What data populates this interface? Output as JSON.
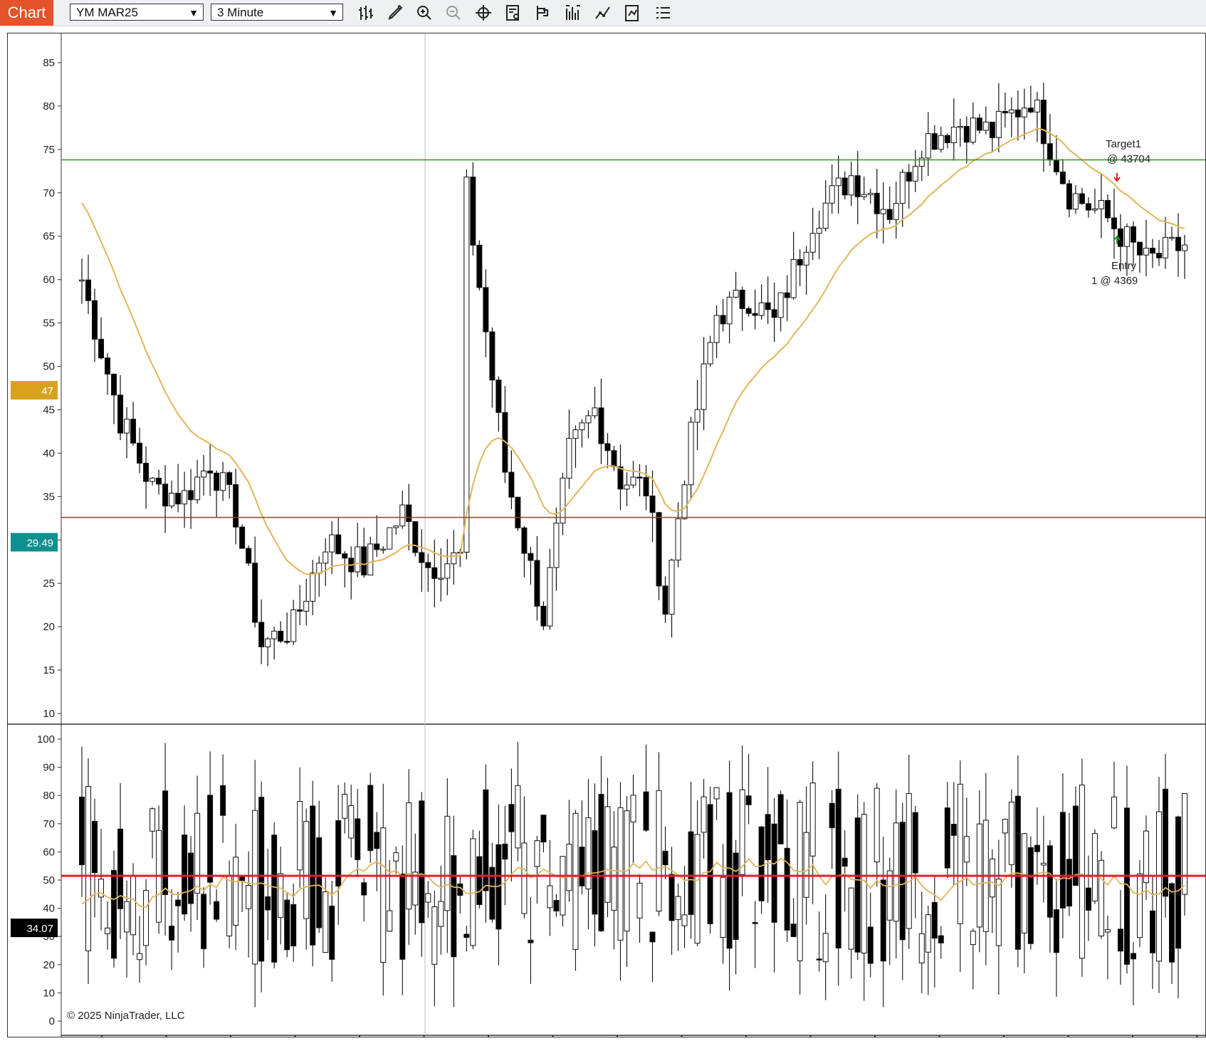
{
  "toolbar": {
    "tab_label": "Chart",
    "instrument": "YM MAR25",
    "interval": "3 Minute",
    "icons": [
      "bar-type-icon",
      "pencil-icon",
      "zoom-in-icon",
      "zoom-out-icon",
      "crosshair-icon",
      "data-box-icon",
      "strategy-icon",
      "indicators-icon",
      "chart-style-icon",
      "properties-icon",
      "object-list-icon"
    ]
  },
  "colors": {
    "accent_tab": "#e4532a",
    "ma_line": "#e3b55a",
    "target_line": "#1f9b1f",
    "level_line": "#e8192c",
    "label_gold": "#d9a21e",
    "label_teal": "#0f8f8f",
    "label_black": "#000000"
  },
  "annotations": {
    "target_label": "Target1",
    "target_price": "@ 43704",
    "entry_label": "Entry",
    "entry_price": "1 @ 4369",
    "copyright": "© 2025 NinjaTrader, LLC"
  },
  "chart_data": [
    {
      "type": "candlestick",
      "panel": "price",
      "y_ticks": [
        "85",
        "80",
        "75",
        "70",
        "65",
        "60",
        "55",
        "50",
        "45",
        "40",
        "35",
        "30",
        "25",
        "20",
        "15",
        "10"
      ],
      "ylim": [
        10,
        87
      ],
      "markers": {
        "gold_value": "47",
        "teal_value": "29.49"
      },
      "horizontal_lines": [
        {
          "name": "target",
          "value": 73.8
        },
        {
          "name": "level",
          "value": 32.6
        }
      ],
      "series_shape": [
        {
          "i": 0,
          "v": 60
        },
        {
          "i": 6,
          "v": 44
        },
        {
          "i": 11,
          "v": 36
        },
        {
          "i": 16,
          "v": 35
        },
        {
          "i": 20,
          "v": 39
        },
        {
          "i": 24,
          "v": 33
        },
        {
          "i": 28,
          "v": 18
        },
        {
          "i": 33,
          "v": 20
        },
        {
          "i": 38,
          "v": 30
        },
        {
          "i": 44,
          "v": 27
        },
        {
          "i": 50,
          "v": 33
        },
        {
          "i": 54,
          "v": 27
        },
        {
          "i": 59,
          "v": 28
        },
        {
          "i": 60,
          "v": 70
        },
        {
          "i": 66,
          "v": 38
        },
        {
          "i": 72,
          "v": 21
        },
        {
          "i": 76,
          "v": 40
        },
        {
          "i": 80,
          "v": 45
        },
        {
          "i": 84,
          "v": 37
        },
        {
          "i": 88,
          "v": 36
        },
        {
          "i": 91,
          "v": 22
        },
        {
          "i": 94,
          "v": 38
        },
        {
          "i": 99,
          "v": 56
        },
        {
          "i": 104,
          "v": 58
        },
        {
          "i": 108,
          "v": 55
        },
        {
          "i": 114,
          "v": 67
        },
        {
          "i": 120,
          "v": 72
        },
        {
          "i": 126,
          "v": 68
        },
        {
          "i": 131,
          "v": 76
        },
        {
          "i": 137,
          "v": 78
        },
        {
          "i": 142,
          "v": 77
        },
        {
          "i": 148,
          "v": 81
        },
        {
          "i": 154,
          "v": 70
        },
        {
          "i": 160,
          "v": 67
        },
        {
          "i": 166,
          "v": 62
        },
        {
          "i": 172,
          "v": 64
        }
      ]
    },
    {
      "type": "candlestick",
      "panel": "oscillator",
      "y_ticks": [
        "100",
        "90",
        "80",
        "70",
        "60",
        "50",
        "40",
        "30",
        "20",
        "10",
        "0"
      ],
      "ylim": [
        0,
        100
      ],
      "markers": {
        "black_value": "34.07"
      },
      "horizontal_lines": [
        {
          "name": "midline",
          "value": 51.5
        }
      ]
    }
  ],
  "x_ticks_count": 18
}
